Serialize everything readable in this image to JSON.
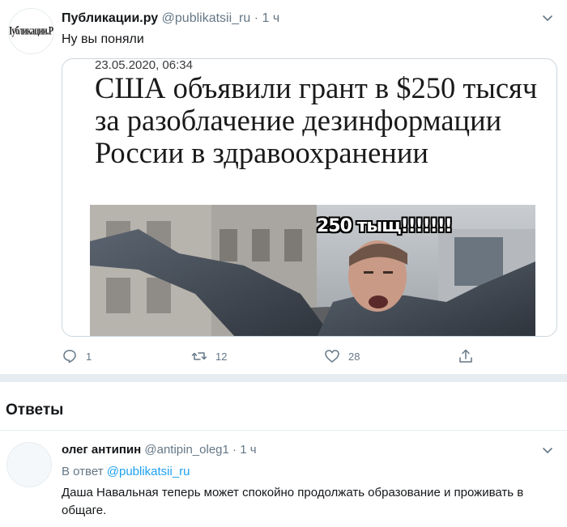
{
  "tweet": {
    "author_name": "Публикации.ру",
    "author_handle": "@publikatsii_ru",
    "separator": "·",
    "time": "1 ч",
    "text": "Ну вы поняли",
    "avatar_logo_text": "Публикации.Ру",
    "media": {
      "date": "23.05.2020, 06:34",
      "headline": "США объявили грант в $250 тысяч за разоблачение дезинформации России в здравоохранении",
      "caption": "250 тыщ!!!!!!!"
    },
    "actions": {
      "reply": {
        "icon": "reply-icon",
        "count": "1"
      },
      "retweet": {
        "icon": "retweet-icon",
        "count": "12"
      },
      "like": {
        "icon": "heart-icon",
        "count": "28"
      },
      "share": {
        "icon": "share-icon"
      }
    }
  },
  "replies": {
    "title": "Ответы",
    "items": [
      {
        "author_name": "олег антипин",
        "author_handle": "@antipin_oleg1",
        "separator": "·",
        "time": "1 ч",
        "reply_to_label": "В ответ",
        "reply_to_handle": "@publikatsii_ru",
        "text": "Даша Навальная теперь может спокойно продолжать образование и проживать в общаге."
      }
    ]
  },
  "colors": {
    "text": "#14171a",
    "muted": "#657786",
    "link": "#1da1f2",
    "border": "#e6ecf0"
  }
}
